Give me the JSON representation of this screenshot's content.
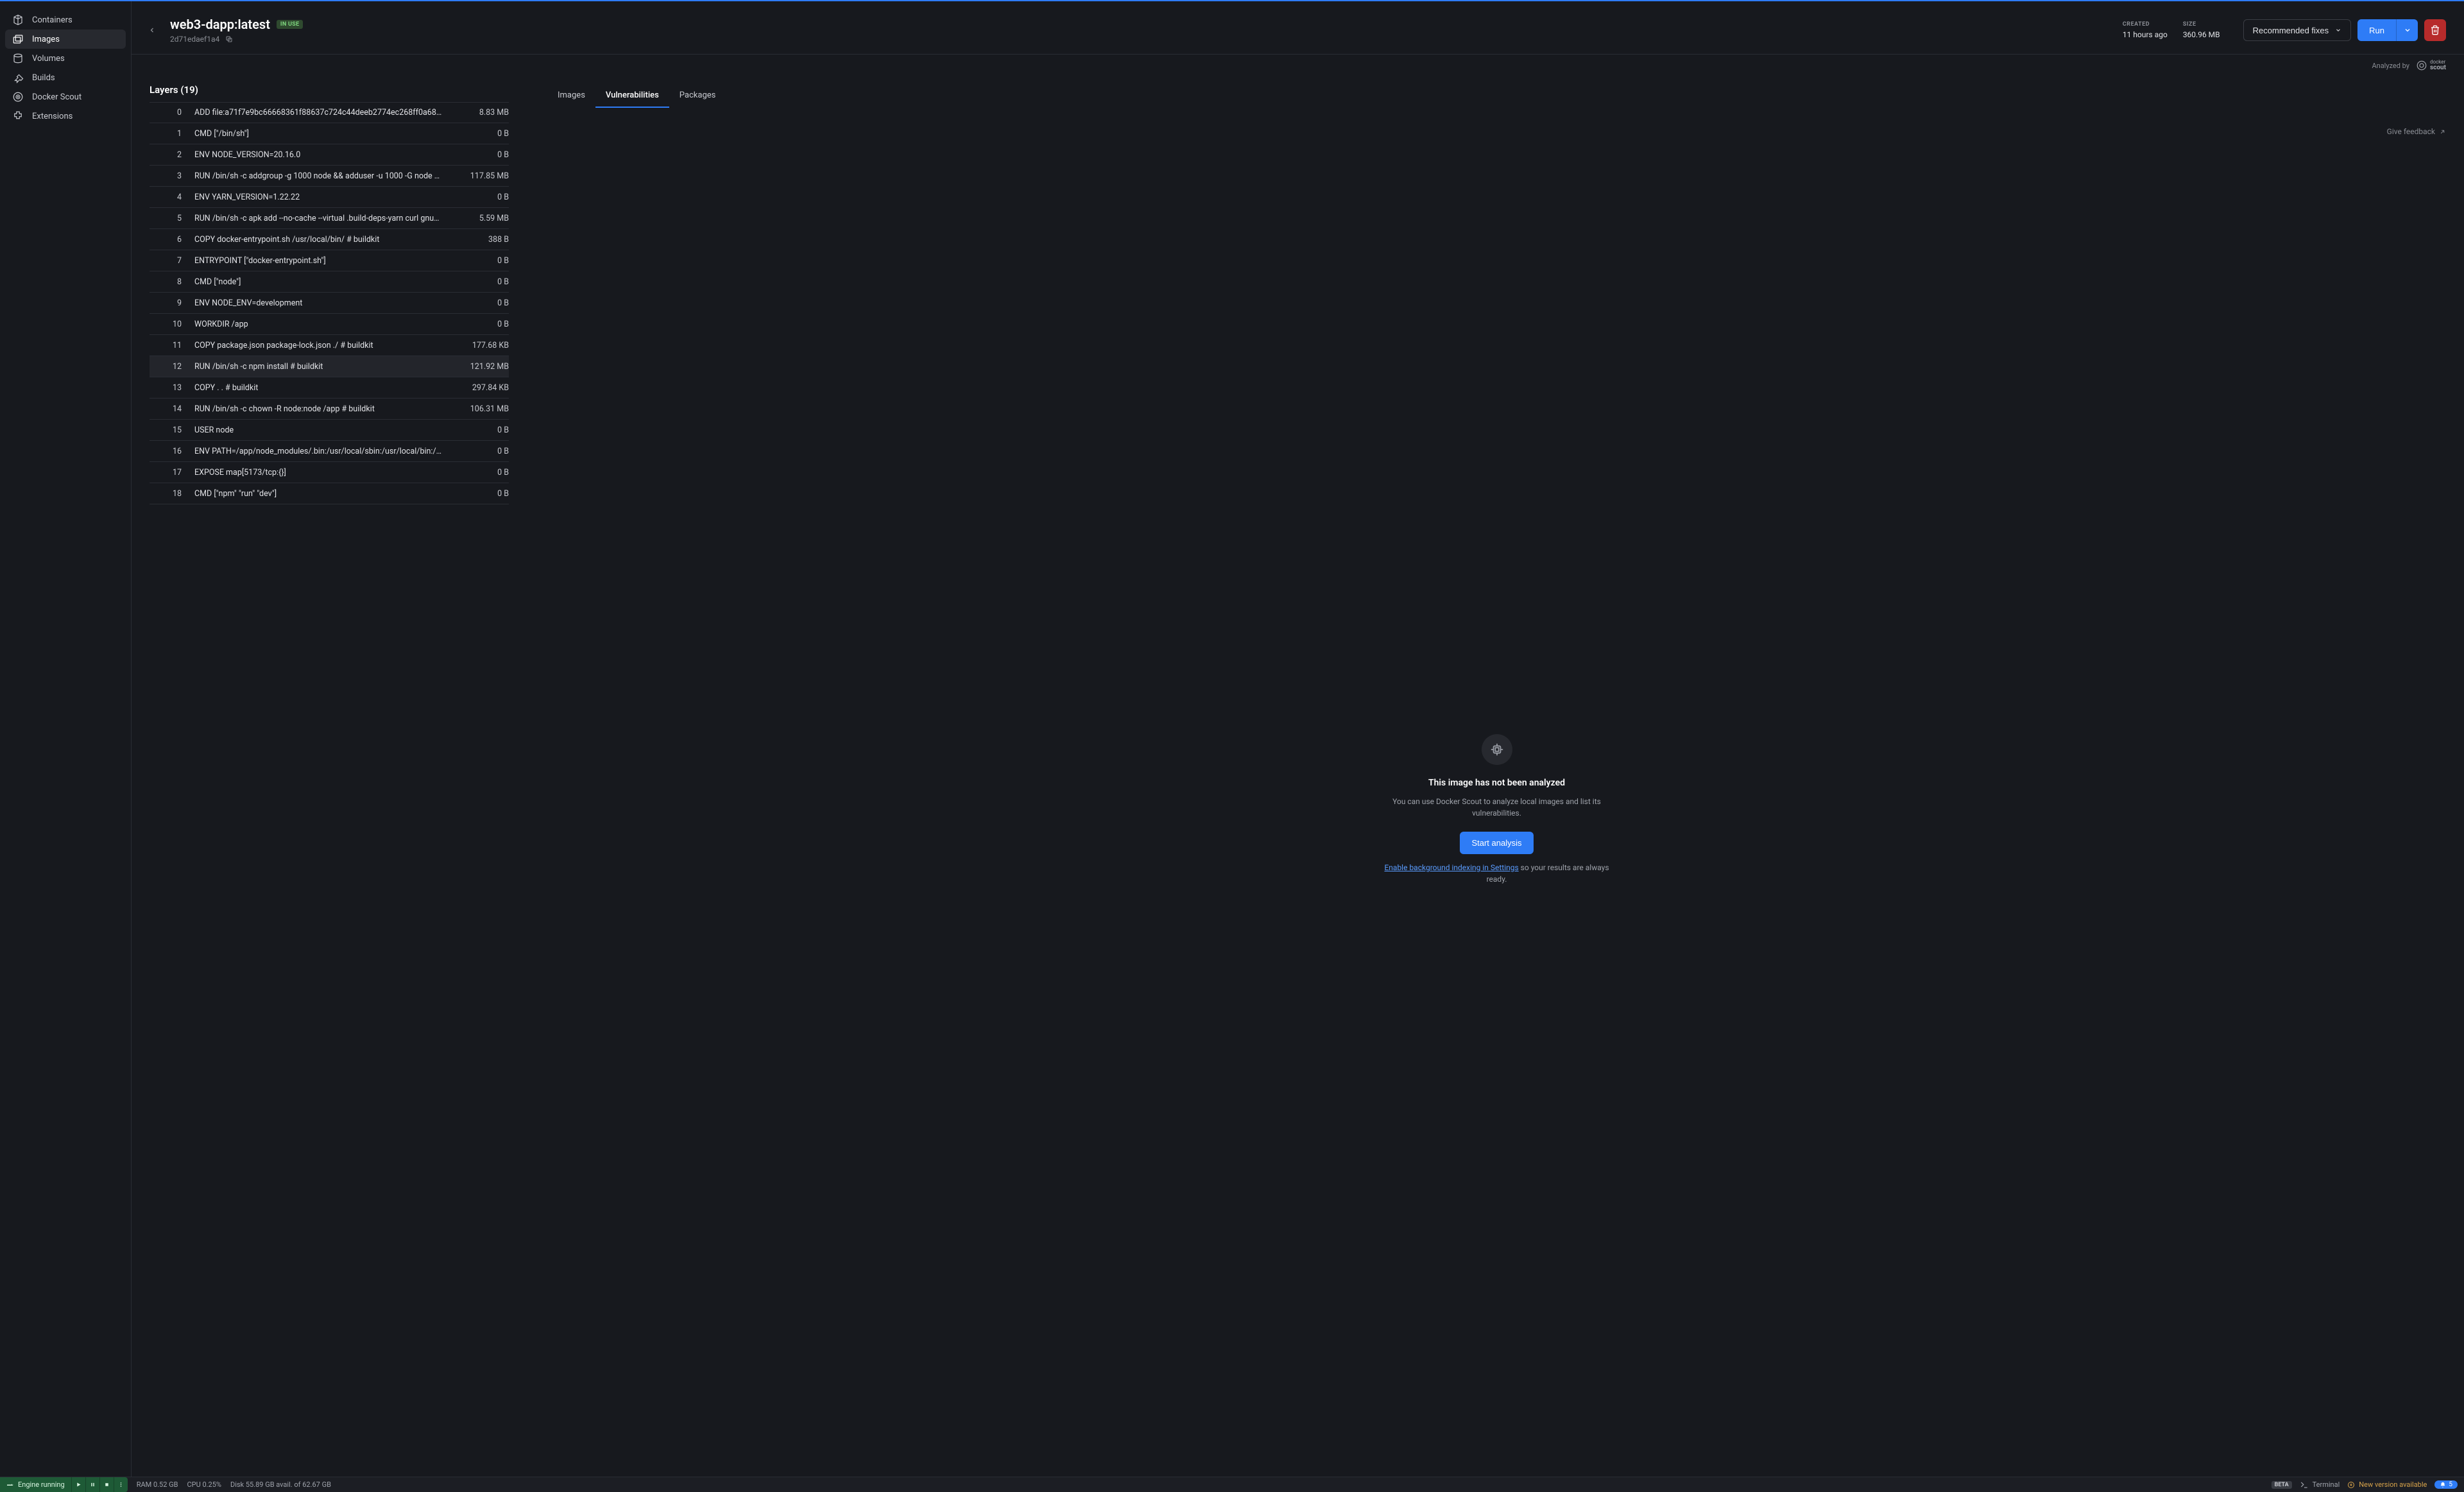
{
  "sidebar": {
    "items": [
      {
        "label": "Containers",
        "icon": "container-icon"
      },
      {
        "label": "Images",
        "icon": "images-icon"
      },
      {
        "label": "Volumes",
        "icon": "volumes-icon"
      },
      {
        "label": "Builds",
        "icon": "builds-icon"
      },
      {
        "label": "Docker Scout",
        "icon": "scout-icon"
      },
      {
        "label": "Extensions",
        "icon": "extensions-icon"
      }
    ],
    "active_index": 1
  },
  "header": {
    "title": "web3-dapp:latest",
    "badge": "IN USE",
    "hash": "2d71edaef1a4",
    "created_label": "CREATED",
    "created_value": "11 hours ago",
    "size_label": "SIZE",
    "size_value": "360.96 MB",
    "recommended_label": "Recommended fixes",
    "run_label": "Run"
  },
  "subheader": {
    "analyzed_by": "Analyzed by",
    "scout_name": "docker scout"
  },
  "layers_panel": {
    "title": "Layers (19)",
    "hovered_index": 12,
    "rows": [
      {
        "idx": "0",
        "cmd": "ADD file:a71f7e9bc66668361f88637c724c44deeb2774ec268ff0a68…",
        "size": "8.83 MB"
      },
      {
        "idx": "1",
        "cmd": "CMD [\"/bin/sh\"]",
        "size": "0 B"
      },
      {
        "idx": "2",
        "cmd": "ENV NODE_VERSION=20.16.0",
        "size": "0 B"
      },
      {
        "idx": "3",
        "cmd": "RUN /bin/sh -c addgroup -g 1000 node && adduser -u 1000 -G node …",
        "size": "117.85 MB"
      },
      {
        "idx": "4",
        "cmd": "ENV YARN_VERSION=1.22.22",
        "size": "0 B"
      },
      {
        "idx": "5",
        "cmd": "RUN /bin/sh -c apk add --no-cache --virtual .build-deps-yarn curl gnu…",
        "size": "5.59 MB"
      },
      {
        "idx": "6",
        "cmd": "COPY docker-entrypoint.sh /usr/local/bin/ # buildkit",
        "size": "388 B"
      },
      {
        "idx": "7",
        "cmd": "ENTRYPOINT [\"docker-entrypoint.sh\"]",
        "size": "0 B"
      },
      {
        "idx": "8",
        "cmd": "CMD [\"node\"]",
        "size": "0 B"
      },
      {
        "idx": "9",
        "cmd": "ENV NODE_ENV=development",
        "size": "0 B"
      },
      {
        "idx": "10",
        "cmd": "WORKDIR /app",
        "size": "0 B"
      },
      {
        "idx": "11",
        "cmd": "COPY package.json package-lock.json ./ # buildkit",
        "size": "177.68 KB"
      },
      {
        "idx": "12",
        "cmd": "RUN /bin/sh -c npm install # buildkit",
        "size": "121.92 MB"
      },
      {
        "idx": "13",
        "cmd": "COPY . . # buildkit",
        "size": "297.84 KB"
      },
      {
        "idx": "14",
        "cmd": "RUN /bin/sh -c chown -R node:node /app # buildkit",
        "size": "106.31 MB"
      },
      {
        "idx": "15",
        "cmd": "USER node",
        "size": "0 B"
      },
      {
        "idx": "16",
        "cmd": "ENV PATH=/app/node_modules/.bin:/usr/local/sbin:/usr/local/bin:/…",
        "size": "0 B"
      },
      {
        "idx": "17",
        "cmd": "EXPOSE map[5173/tcp:{}]",
        "size": "0 B"
      },
      {
        "idx": "18",
        "cmd": "CMD [\"npm\" \"run\" \"dev\"]",
        "size": "0 B"
      }
    ]
  },
  "right_panel": {
    "tabs": [
      "Images",
      "Vulnerabilities",
      "Packages"
    ],
    "active_tab": 1,
    "feedback_label": "Give feedback",
    "empty_title": "This image has not been analyzed",
    "empty_desc": "You can use Docker Scout to analyze local images and list its vulnerabilities.",
    "start_label": "Start analysis",
    "link_text": "Enable background indexing in Settings",
    "post_link_text": " so your results are always ready."
  },
  "statusbar": {
    "engine": "Engine running",
    "ram": "RAM 0.52 GB",
    "cpu": "CPU 0.25%",
    "disk": "Disk 55.89 GB avail. of 62.67 GB",
    "beta": "BETA",
    "terminal": "Terminal",
    "update": "New version available",
    "notif_count": "5"
  }
}
